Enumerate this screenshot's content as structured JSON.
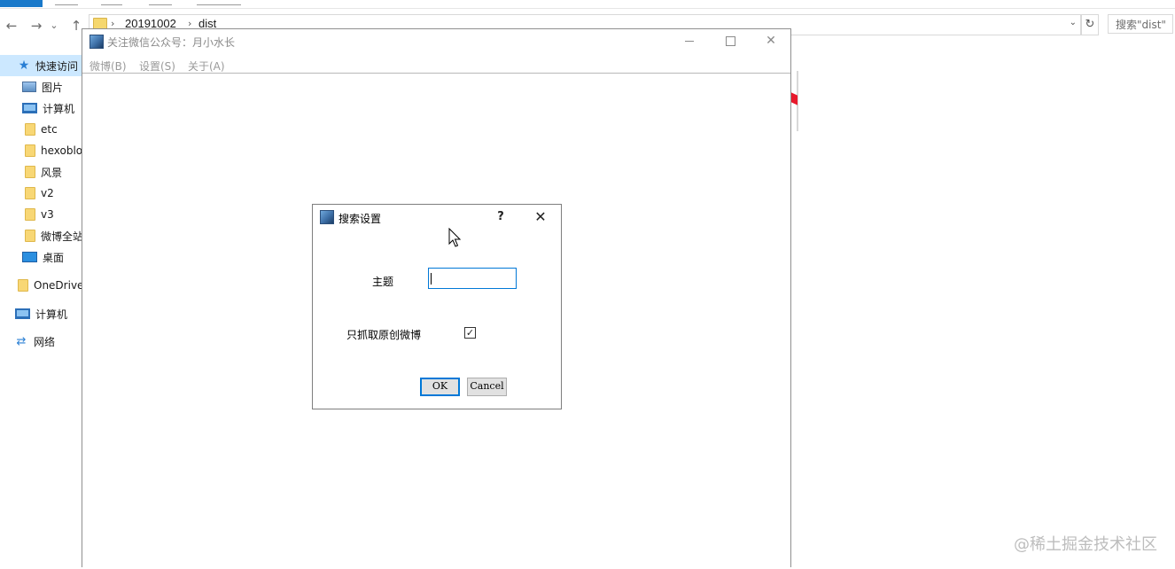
{
  "explorer": {
    "address": {
      "crumbs": [
        "20191002",
        "dist"
      ],
      "separator": "›"
    },
    "search_placeholder": "搜索\"dist\"",
    "nav_buttons": {
      "back": "←",
      "forward": "→",
      "recent": "⌄",
      "up": "↑",
      "refresh": "↻",
      "dropdown": "⌄"
    },
    "nav_pane": [
      {
        "label": "快速访问",
        "icon": "star-icon",
        "selected": true
      },
      {
        "label": "图片",
        "icon": "pictures-icon"
      },
      {
        "label": "计算机",
        "icon": "computer-icon"
      },
      {
        "label": "etc",
        "icon": "folder-icon"
      },
      {
        "label": "hexoblo",
        "icon": "folder-icon"
      },
      {
        "label": "风景",
        "icon": "folder-icon"
      },
      {
        "label": "v2",
        "icon": "folder-icon"
      },
      {
        "label": "v3",
        "icon": "folder-icon"
      },
      {
        "label": "微博全站",
        "icon": "folder-icon"
      },
      {
        "label": "桌面",
        "icon": "desktop-icon"
      },
      {
        "label": "OneDrive",
        "icon": "folder-icon"
      },
      {
        "label": "计算机",
        "icon": "computer-icon"
      },
      {
        "label": "网络",
        "icon": "network-icon"
      }
    ]
  },
  "app": {
    "title": "关注微信公众号：月小水长",
    "menu": [
      "微博(B)",
      "设置(S)",
      "关于(A)"
    ],
    "controls": {
      "close": "✕"
    }
  },
  "dialog": {
    "title": "搜索设置",
    "help": "?",
    "close": "✕",
    "topic_label": "主题",
    "topic_value": "",
    "original_only_label": "只抓取原创微博",
    "original_only_checked": true,
    "check_mark": "✓",
    "ok_label": "OK",
    "cancel_label": "Cancel"
  },
  "watermark": "@稀土掘金技术社区",
  "colors": {
    "accent_blue": "#0078d7",
    "selection": "#cce8ff",
    "file_tab": "#1979ca",
    "muted_text": "#8a8a8a"
  }
}
